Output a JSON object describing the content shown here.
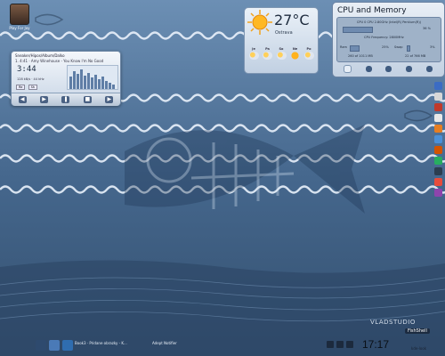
{
  "desktop": {
    "icon_label": "Play For Joy"
  },
  "player": {
    "header": "Sneaker/Hipos/Album/Dalko",
    "track_line": "1. 4:41  ·  Amy Winehouse - You Know I'm No Good",
    "time": "3:44",
    "meta": "128 kB/s · 44 kHz",
    "buttons": [
      "Re",
      "Sh"
    ]
  },
  "weather": {
    "temperature": "27°C",
    "city": "Ostrava",
    "forecast": [
      {
        "day": "Je",
        "sunny": false
      },
      {
        "day": "Pa",
        "sunny": false
      },
      {
        "day": "So",
        "sunny": false
      },
      {
        "day": "Ne",
        "sunny": true
      },
      {
        "day": "Po",
        "sunny": false
      }
    ]
  },
  "cpu_widget": {
    "title": "CPU and Memory",
    "cpu_name": "CPU 0 CPU 2.80GHz (Intel(R) Pentium(R))",
    "cpu_usage": "36 %",
    "cpu_usage_fraction": 0.36,
    "cpu_freq": "CPU Frequency: 2800MHz",
    "ram_label": "Ram",
    "ram_usage": "25%",
    "ram_fraction": 0.25,
    "ram_detail": "260 of 1011 MB",
    "swap_label": "Swap",
    "swap_usage": "3%",
    "swap_fraction": 0.03,
    "swap_detail": "22 of 766 MB"
  },
  "taskbar": {
    "tasks": [
      "Book3 · Pridane obrazky - K...",
      "Adept Notifier"
    ]
  },
  "tray": {
    "badge": "FishShell"
  },
  "clock": {
    "time": "17:17"
  },
  "wallpaper": {
    "brand": "VLADSTUDIO",
    "credit": "kde-look"
  },
  "colors": {
    "sky": "#4d6f94",
    "panel": "#c9d6e6",
    "accent": "#3f5b80"
  }
}
